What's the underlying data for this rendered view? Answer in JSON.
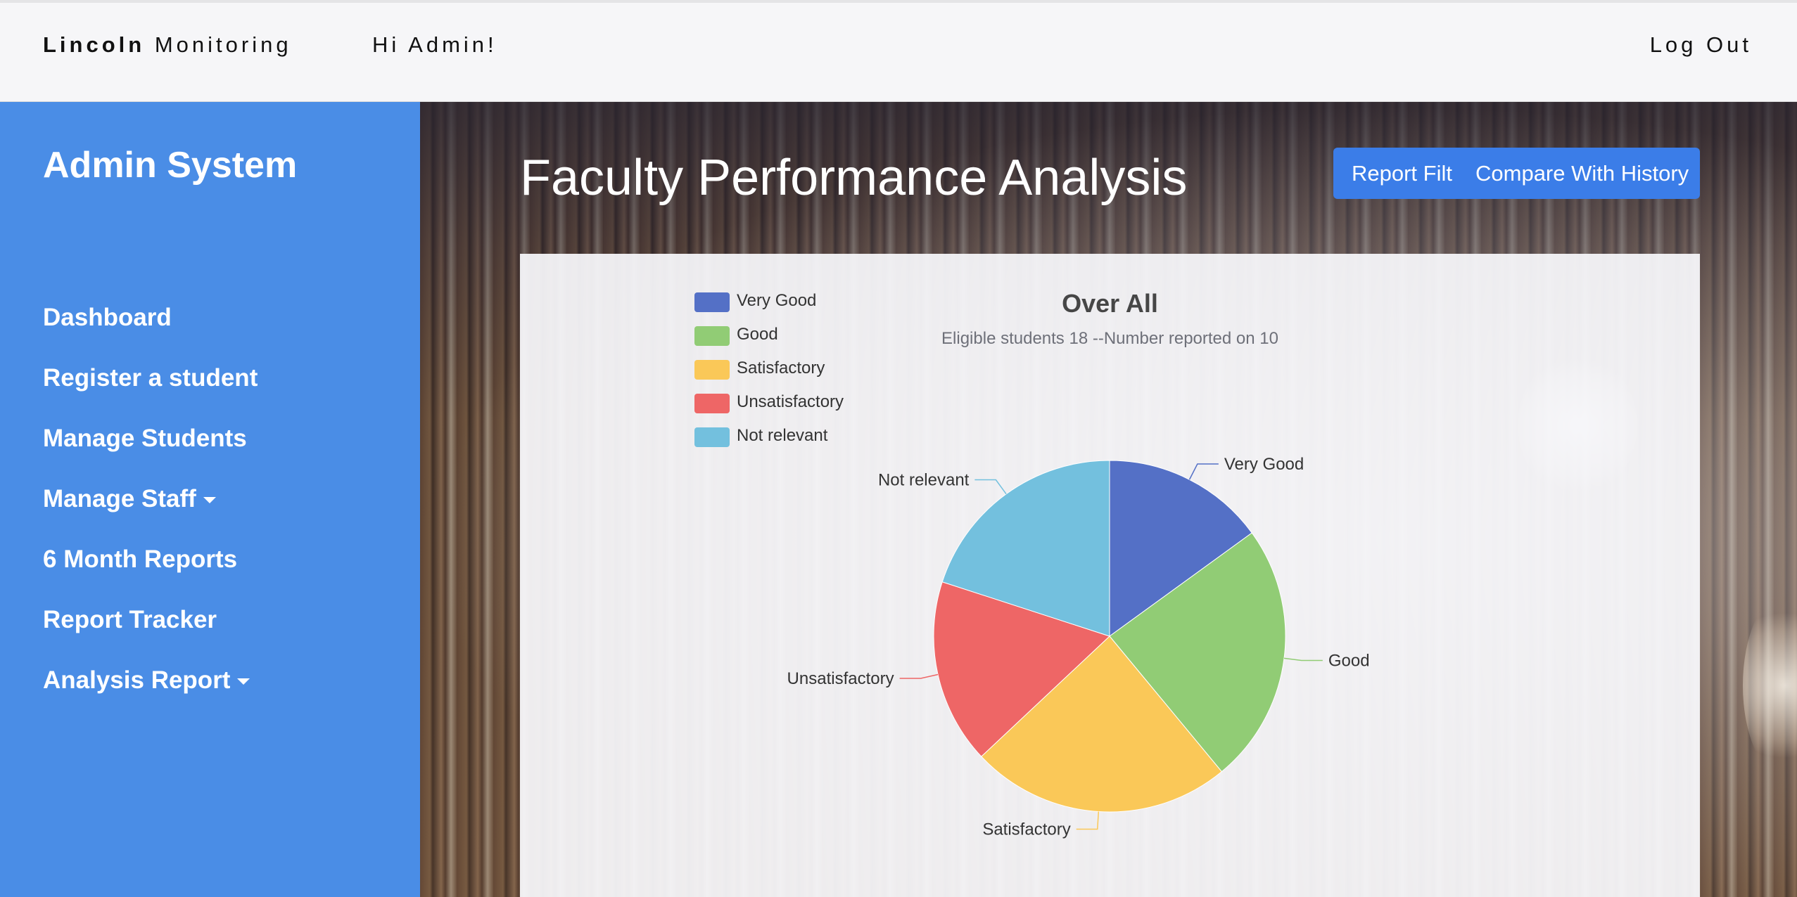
{
  "navbar": {
    "brand_bold": "Lincoln",
    "brand_rest": "Monitoring",
    "greeting": "Hi Admin!",
    "logout": "Log Out"
  },
  "sidebar": {
    "title": "Admin System",
    "items": [
      {
        "label": "Dashboard",
        "dropdown": false
      },
      {
        "label": "Register a student",
        "dropdown": false
      },
      {
        "label": "Manage Students",
        "dropdown": false
      },
      {
        "label": "Manage Staff",
        "dropdown": true
      },
      {
        "label": "6 Month Reports",
        "dropdown": false
      },
      {
        "label": "Report Tracker",
        "dropdown": false
      },
      {
        "label": "Analysis Report",
        "dropdown": true
      }
    ]
  },
  "main": {
    "title": "Faculty Performance Analysis",
    "buttons": {
      "report_filter": "Report Filt",
      "compare": "Compare With History"
    }
  },
  "chart_data": {
    "type": "pie",
    "title": "Over All",
    "subtitle": "Eligible students 18 --Number reported on 10",
    "legend_position": "top-left",
    "slices": [
      {
        "label": "Very Good",
        "value": 15,
        "color": "#5470c6"
      },
      {
        "label": "Good",
        "value": 24,
        "color": "#91cc75"
      },
      {
        "label": "Satisfactory",
        "value": 24,
        "color": "#fac858"
      },
      {
        "label": "Unsatisfactory",
        "value": 17,
        "color": "#ee6666"
      },
      {
        "label": "Not relevant",
        "value": 20,
        "color": "#73c0de"
      }
    ]
  }
}
